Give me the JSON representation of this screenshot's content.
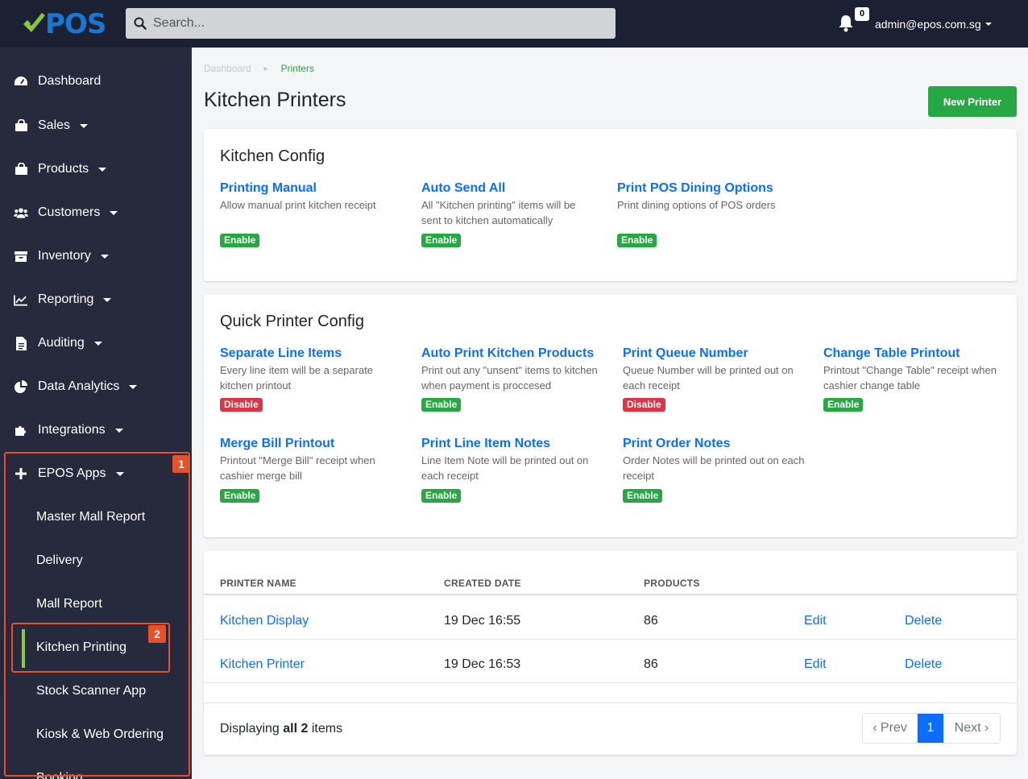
{
  "brand": {
    "logo_text": "POS"
  },
  "search": {
    "placeholder": "Search..."
  },
  "notifications": {
    "count": "0"
  },
  "user": {
    "email": "admin@epos.com.sg"
  },
  "sidebar": {
    "items": [
      {
        "label": "Dashboard"
      },
      {
        "label": "Sales"
      },
      {
        "label": "Products"
      },
      {
        "label": "Customers"
      },
      {
        "label": "Inventory"
      },
      {
        "label": "Reporting"
      },
      {
        "label": "Auditing"
      },
      {
        "label": "Data Analytics"
      },
      {
        "label": "Integrations"
      },
      {
        "label": "EPOS Apps"
      }
    ],
    "apps": [
      "Master Mall Report",
      "Delivery",
      "Mall Report",
      "Kitchen Printing",
      "Stock Scanner App",
      "Kiosk & Web Ordering",
      "Booking"
    ],
    "annotations": [
      "1",
      "2"
    ]
  },
  "breadcrumb": {
    "home": "Dashboard",
    "current": "Printers"
  },
  "page": {
    "title": "Kitchen Printers",
    "new_button": "New Printer"
  },
  "kitchen_config": {
    "title": "Kitchen Config",
    "options": [
      {
        "title": "Printing Manual",
        "desc": "Allow manual print kitchen receipt",
        "status": "Enable"
      },
      {
        "title": "Auto Send All",
        "desc": "All \"Kitchen printing\" items will be sent to kitchen automatically",
        "status": "Enable"
      },
      {
        "title": "Print POS Dining Options",
        "desc": "Print dining options of POS orders",
        "status": "Enable"
      }
    ]
  },
  "quick_config": {
    "title": "Quick Printer Config",
    "options": [
      {
        "title": "Separate Line Items",
        "desc": "Every line item will be a separate kitchen printout",
        "status": "Disable"
      },
      {
        "title": "Auto Print Kitchen Products",
        "desc": "Print out any \"unsent\" items to kitchen when payment is proccesed",
        "status": "Enable"
      },
      {
        "title": "Print Queue Number",
        "desc": "Queue Number will be printed out on each receipt",
        "status": "Disable"
      },
      {
        "title": "Change Table Printout",
        "desc": "Printout \"Change Table\" receipt when cashier change table",
        "status": "Enable"
      },
      {
        "title": "Merge Bill Printout",
        "desc": "Printout \"Merge Bill\" receipt when cashier merge bill",
        "status": "Enable"
      },
      {
        "title": "Print Line Item Notes",
        "desc": "Line Item Note will be printed out on each receipt",
        "status": "Enable"
      },
      {
        "title": "Print Order Notes",
        "desc": "Order Notes will be printed out on each receipt",
        "status": "Enable"
      }
    ]
  },
  "table": {
    "headers": [
      "PRINTER NAME",
      "CREATED DATE",
      "PRODUCTS"
    ],
    "rows": [
      {
        "name": "Kitchen Display",
        "date": "19 Dec 16:55",
        "products": "86",
        "edit": "Edit",
        "delete": "Delete"
      },
      {
        "name": "Kitchen Printer",
        "date": "19 Dec 16:53",
        "products": "86",
        "edit": "Edit",
        "delete": "Delete"
      }
    ],
    "footer_prefix": "Displaying",
    "footer_bold": "all 2",
    "footer_suffix": "items",
    "pager": {
      "prev": "‹ Prev",
      "current": "1",
      "next": "Next ›"
    }
  },
  "colors": {
    "topbar": "#1c2033",
    "sidebar": "#262a3c",
    "accent_green": "#28a745",
    "link_blue": "#0d6efd",
    "danger": "#dc3545",
    "highlight": "#e8502a"
  }
}
